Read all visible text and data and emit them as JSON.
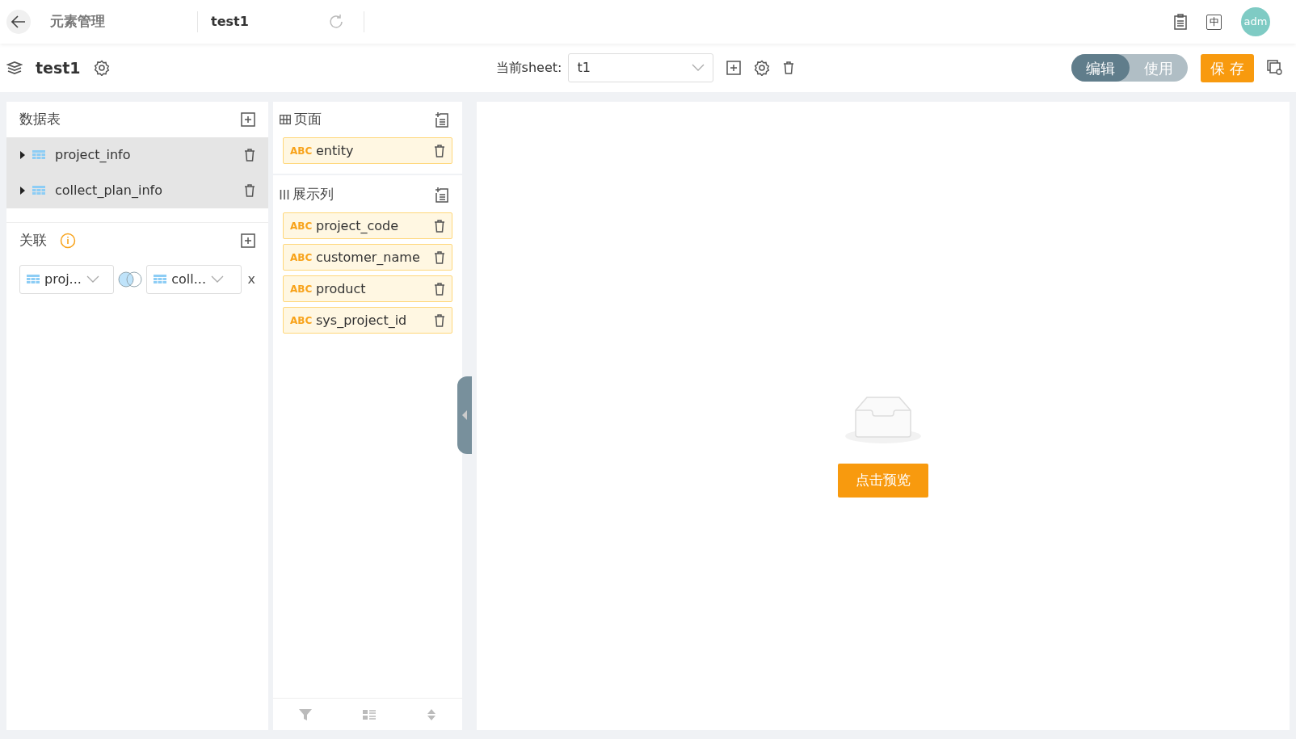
{
  "top_bar": {
    "back_label": "元素管理",
    "tab_title": "test1",
    "language": "中",
    "avatar": "adm"
  },
  "toolbar": {
    "title": "test1",
    "sheet_label": "当前sheet:",
    "sheet_value": "t1",
    "mode_toggle": [
      {
        "label": "编辑",
        "selected": true
      },
      {
        "label": "使用",
        "selected": false
      }
    ],
    "save_button": "保 存"
  },
  "data_tables": {
    "title": "数据表",
    "items": [
      {
        "name": "project_info",
        "expanded": false
      },
      {
        "name": "collect_plan_info",
        "expanded": false
      }
    ]
  },
  "relations": {
    "title": "关联",
    "left_table": "proj...",
    "right_table": "coll...",
    "remove": "x"
  },
  "page_section": {
    "title": "页面",
    "fields": [
      {
        "type": "ABC",
        "name": "entity"
      }
    ]
  },
  "columns_section": {
    "title": "展示列",
    "fields": [
      {
        "type": "ABC",
        "name": "project_code"
      },
      {
        "type": "ABC",
        "name": "customer_name"
      },
      {
        "type": "ABC",
        "name": "product"
      },
      {
        "type": "ABC",
        "name": "sys_project_id"
      }
    ]
  },
  "preview": {
    "button": "点击预览"
  }
}
